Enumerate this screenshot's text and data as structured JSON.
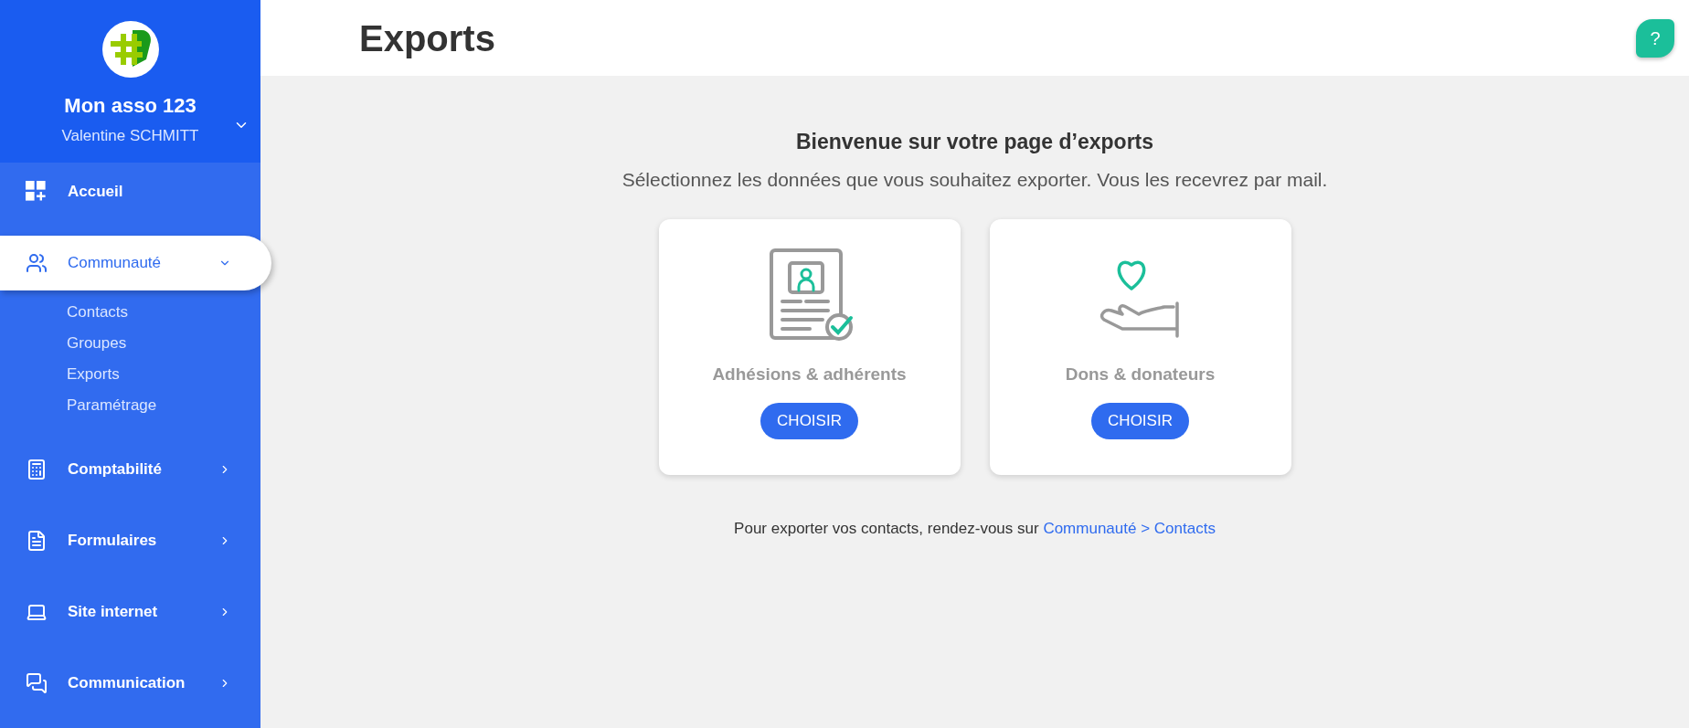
{
  "sidebar": {
    "org_name": "Mon asso 123",
    "user_name": "Valentine SCHMITT",
    "items": [
      {
        "label": "Accueil",
        "selected": false
      },
      {
        "label": "Communauté",
        "selected": true,
        "expanded": true,
        "children": [
          {
            "label": "Contacts"
          },
          {
            "label": "Groupes"
          },
          {
            "label": "Exports"
          },
          {
            "label": "Paramétrage"
          }
        ]
      },
      {
        "label": "Comptabilité",
        "selected": false,
        "expanded": false
      },
      {
        "label": "Formulaires",
        "selected": false,
        "expanded": false
      },
      {
        "label": "Site internet",
        "selected": false,
        "expanded": false
      },
      {
        "label": "Communication",
        "selected": false,
        "expanded": false
      }
    ]
  },
  "header": {
    "title": "Exports",
    "help": "?"
  },
  "intro": {
    "title": "Bienvenue sur votre page d’exports",
    "subtitle": "Sélectionnez les données que vous souhaitez exporter. Vous les recevrez par mail."
  },
  "cards": [
    {
      "kind": "membership",
      "title": "Adhésions & adhérents",
      "button": "CHOISIR"
    },
    {
      "kind": "donation",
      "title": "Dons & donateurs",
      "button": "CHOISIR"
    }
  ],
  "footer": {
    "text": "Pour exporter vos contacts, rendez-vous sur ",
    "link": "Communauté > Contacts"
  }
}
